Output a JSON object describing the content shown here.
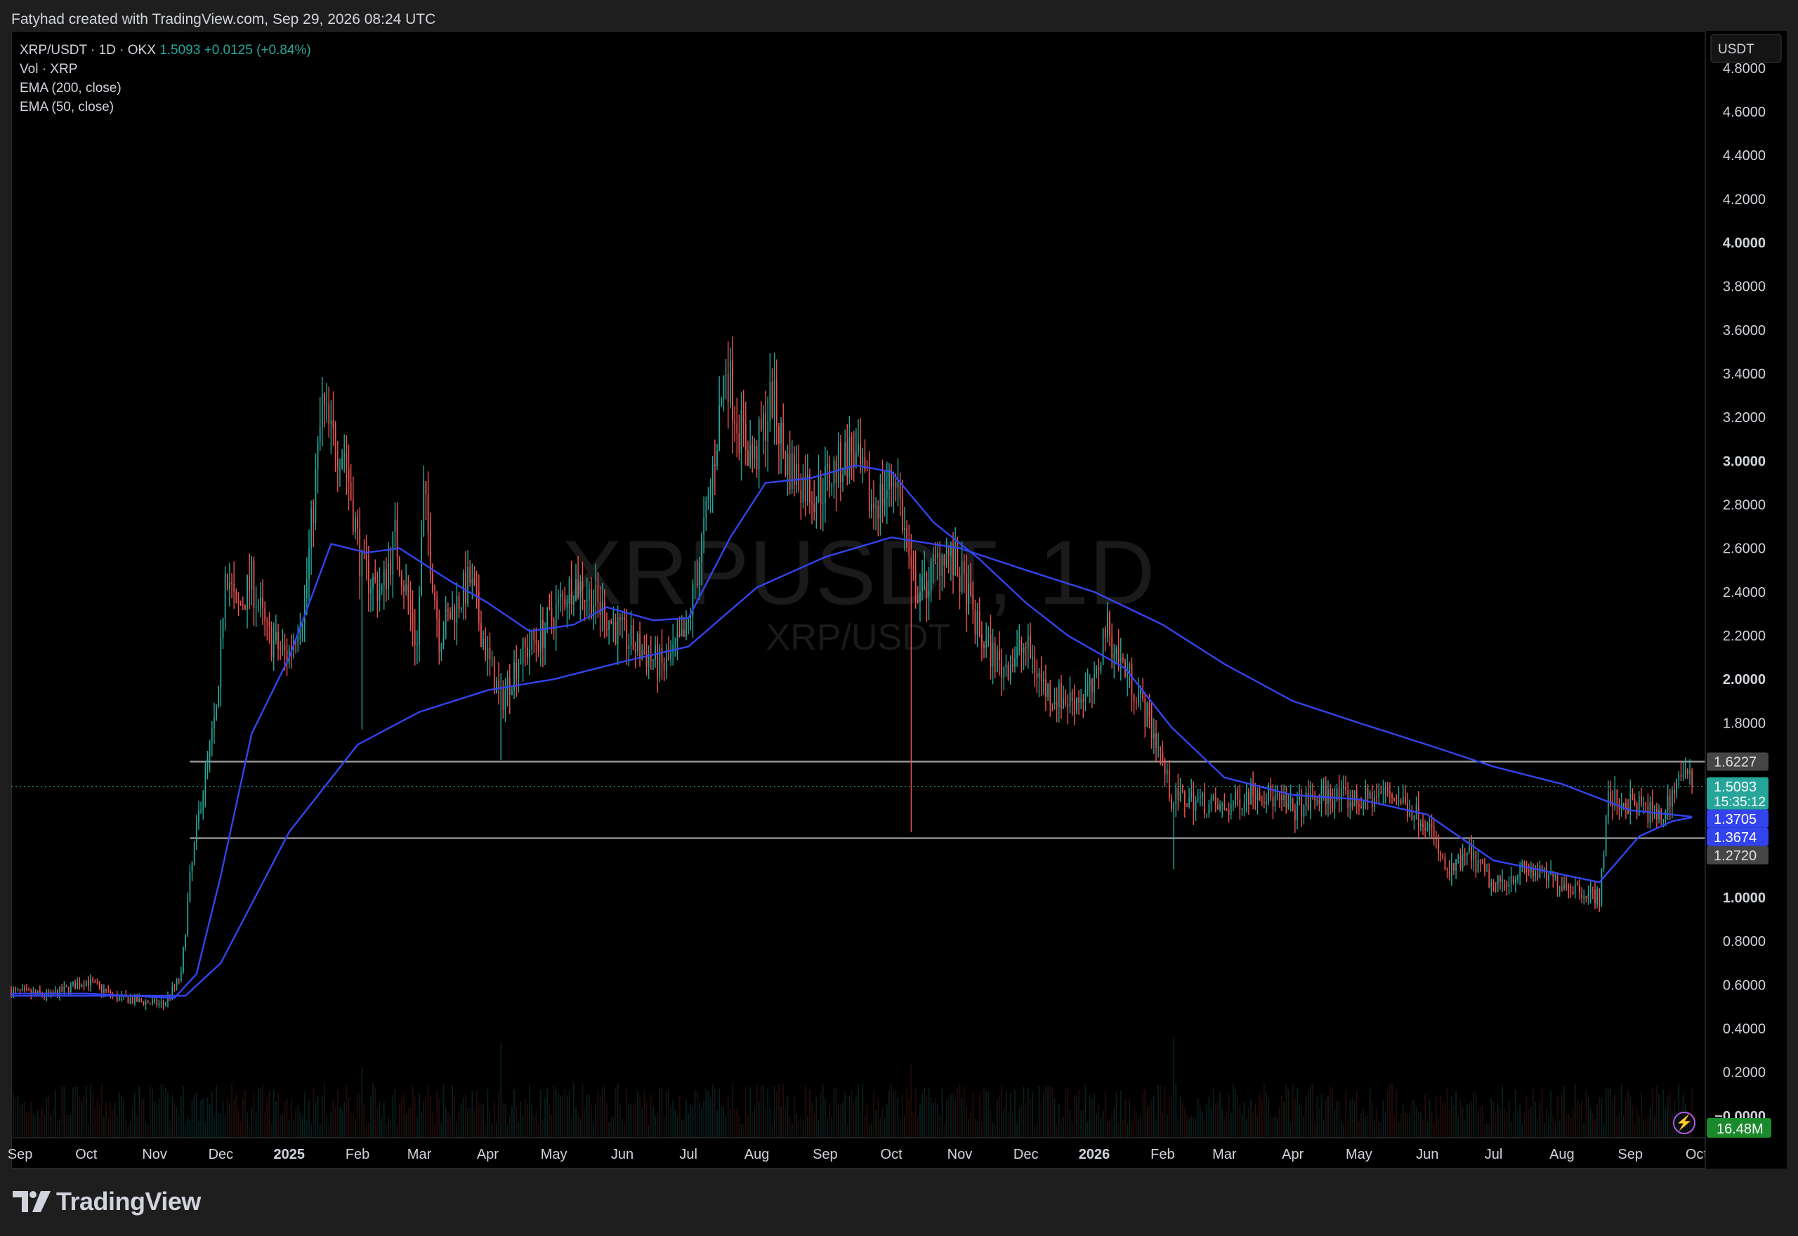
{
  "header": {
    "credit": "Fatyhad created with TradingView.com, Sep 29, 2026 08:24 UTC"
  },
  "legend": {
    "symbol": "XRP/USDT · 1D · OKX",
    "last": "1.5093",
    "change": "+0.0125 (+0.84%)",
    "vol": "Vol · XRP",
    "ema200": "EMA (200, close)",
    "ema50": "EMA (50, close)"
  },
  "watermark": {
    "big": "XRPUSDT, 1D",
    "small": "XRP/USDT"
  },
  "brand": {
    "name": "TradingView"
  },
  "colors": {
    "up": "#26a69a",
    "down": "#ef5350",
    "ema": "#3344ee",
    "level_line": "#9e9e9e",
    "last_price_badge": "#26a69a",
    "volume_badge": "#1b8a2d"
  },
  "icons": [
    "tradingview-logo-icon",
    "bolt-icon"
  ],
  "chart_data": {
    "type": "candlestick",
    "currency_label": "USDT",
    "ylim": [
      -0.1,
      4.97
    ],
    "y_ticks": [
      {
        "label": "4.8000",
        "value": 4.8,
        "bold": false
      },
      {
        "label": "4.6000",
        "value": 4.6,
        "bold": false
      },
      {
        "label": "4.4000",
        "value": 4.4,
        "bold": false
      },
      {
        "label": "4.2000",
        "value": 4.2,
        "bold": false
      },
      {
        "label": "4.0000",
        "value": 4.0,
        "bold": true
      },
      {
        "label": "3.8000",
        "value": 3.8,
        "bold": false
      },
      {
        "label": "3.6000",
        "value": 3.6,
        "bold": false
      },
      {
        "label": "3.4000",
        "value": 3.4,
        "bold": false
      },
      {
        "label": "3.2000",
        "value": 3.2,
        "bold": false
      },
      {
        "label": "3.0000",
        "value": 3.0,
        "bold": true
      },
      {
        "label": "2.8000",
        "value": 2.8,
        "bold": false
      },
      {
        "label": "2.6000",
        "value": 2.6,
        "bold": false
      },
      {
        "label": "2.4000",
        "value": 2.4,
        "bold": false
      },
      {
        "label": "2.2000",
        "value": 2.2,
        "bold": false
      },
      {
        "label": "2.0000",
        "value": 2.0,
        "bold": true
      },
      {
        "label": "1.8000",
        "value": 1.8,
        "bold": false
      },
      {
        "label": "1.0000",
        "value": 1.0,
        "bold": true
      },
      {
        "label": "0.8000",
        "value": 0.8,
        "bold": false
      },
      {
        "label": "0.6000",
        "value": 0.6,
        "bold": false
      },
      {
        "label": "0.4000",
        "value": 0.4,
        "bold": false
      },
      {
        "label": "0.2000",
        "value": 0.2,
        "bold": false
      },
      {
        "label": "−0.0000",
        "value": 0.0,
        "bold": true
      }
    ],
    "x_ticks": [
      {
        "label": "Sep",
        "date": "2024-09-01",
        "bold": false
      },
      {
        "label": "Oct",
        "date": "2024-10-01",
        "bold": false
      },
      {
        "label": "Nov",
        "date": "2024-11-01",
        "bold": false
      },
      {
        "label": "Dec",
        "date": "2024-12-01",
        "bold": false
      },
      {
        "label": "2025",
        "date": "2025-01-01",
        "bold": true
      },
      {
        "label": "Feb",
        "date": "2025-02-01",
        "bold": false
      },
      {
        "label": "Mar",
        "date": "2025-03-01",
        "bold": false
      },
      {
        "label": "Apr",
        "date": "2025-04-01",
        "bold": false
      },
      {
        "label": "May",
        "date": "2025-05-01",
        "bold": false
      },
      {
        "label": "Jun",
        "date": "2025-06-01",
        "bold": false
      },
      {
        "label": "Jul",
        "date": "2025-07-01",
        "bold": false
      },
      {
        "label": "Aug",
        "date": "2025-08-01",
        "bold": false
      },
      {
        "label": "Sep",
        "date": "2025-09-01",
        "bold": false
      },
      {
        "label": "Oct",
        "date": "2025-10-01",
        "bold": false
      },
      {
        "label": "Nov",
        "date": "2025-11-01",
        "bold": false
      },
      {
        "label": "Dec",
        "date": "2025-12-01",
        "bold": false
      },
      {
        "label": "2026",
        "date": "2026-01-01",
        "bold": true
      },
      {
        "label": "Feb",
        "date": "2026-02-01",
        "bold": false
      },
      {
        "label": "Mar",
        "date": "2026-03-01",
        "bold": false
      },
      {
        "label": "Apr",
        "date": "2026-04-01",
        "bold": false
      },
      {
        "label": "May",
        "date": "2026-05-01",
        "bold": false
      },
      {
        "label": "Jun",
        "date": "2026-06-01",
        "bold": false
      },
      {
        "label": "Jul",
        "date": "2026-07-01",
        "bold": false
      },
      {
        "label": "Aug",
        "date": "2026-08-01",
        "bold": false
      },
      {
        "label": "Sep",
        "date": "2026-09-01",
        "bold": false
      },
      {
        "label": "Oct",
        "date": "2026-10-01",
        "bold": false
      }
    ],
    "price_path": [
      [
        "2024-08-28",
        0.57
      ],
      [
        "2024-09-15",
        0.55
      ],
      [
        "2024-10-01",
        0.62
      ],
      [
        "2024-10-15",
        0.54
      ],
      [
        "2024-11-05",
        0.51
      ],
      [
        "2024-11-13",
        0.64
      ],
      [
        "2024-11-17",
        1.08
      ],
      [
        "2024-11-22",
        1.45
      ],
      [
        "2024-11-30",
        1.9
      ],
      [
        "2024-12-03",
        2.55
      ],
      [
        "2024-12-08",
        2.3
      ],
      [
        "2024-12-15",
        2.45
      ],
      [
        "2024-12-22",
        2.2
      ],
      [
        "2024-12-31",
        2.1
      ],
      [
        "2025-01-08",
        2.35
      ],
      [
        "2025-01-16",
        3.25
      ],
      [
        "2025-01-20",
        3.1
      ],
      [
        "2025-01-26",
        3.05
      ],
      [
        "2025-02-03",
        2.5
      ],
      [
        "2025-02-12",
        2.4
      ],
      [
        "2025-02-18",
        2.65
      ],
      [
        "2025-02-28",
        2.15
      ],
      [
        "2025-03-03",
        2.85
      ],
      [
        "2025-03-10",
        2.2
      ],
      [
        "2025-03-18",
        2.35
      ],
      [
        "2025-03-24",
        2.45
      ],
      [
        "2025-04-01",
        2.1
      ],
      [
        "2025-04-07",
        1.9
      ],
      [
        "2025-04-15",
        2.1
      ],
      [
        "2025-04-25",
        2.2
      ],
      [
        "2025-05-10",
        2.45
      ],
      [
        "2025-05-20",
        2.35
      ],
      [
        "2025-06-01",
        2.2
      ],
      [
        "2025-06-20",
        2.05
      ],
      [
        "2025-06-30",
        2.2
      ],
      [
        "2025-07-10",
        2.8
      ],
      [
        "2025-07-18",
        3.45
      ],
      [
        "2025-07-24",
        3.15
      ],
      [
        "2025-07-31",
        3.0
      ],
      [
        "2025-08-08",
        3.3
      ],
      [
        "2025-08-14",
        3.0
      ],
      [
        "2025-08-22",
        2.9
      ],
      [
        "2025-08-28",
        2.85
      ],
      [
        "2025-09-05",
        2.95
      ],
      [
        "2025-09-13",
        3.05
      ],
      [
        "2025-09-22",
        2.8
      ],
      [
        "2025-09-28",
        2.85
      ],
      [
        "2025-10-03",
        2.95
      ],
      [
        "2025-10-10",
        2.45
      ],
      [
        "2025-10-15",
        2.4
      ],
      [
        "2025-10-25",
        2.6
      ],
      [
        "2025-11-02",
        2.45
      ],
      [
        "2025-11-10",
        2.2
      ],
      [
        "2025-11-20",
        2.05
      ],
      [
        "2025-12-01",
        2.15
      ],
      [
        "2025-12-10",
        1.95
      ],
      [
        "2025-12-20",
        1.9
      ],
      [
        "2026-01-01",
        1.95
      ],
      [
        "2026-01-06",
        2.25
      ],
      [
        "2026-01-12",
        2.1
      ],
      [
        "2026-01-20",
        1.95
      ],
      [
        "2026-01-30",
        1.7
      ],
      [
        "2026-02-05",
        1.45
      ],
      [
        "2026-02-15",
        1.45
      ],
      [
        "2026-03-01",
        1.4
      ],
      [
        "2026-03-15",
        1.5
      ],
      [
        "2026-04-01",
        1.4
      ],
      [
        "2026-04-15",
        1.47
      ],
      [
        "2026-05-01",
        1.44
      ],
      [
        "2026-05-15",
        1.48
      ],
      [
        "2026-06-01",
        1.35
      ],
      [
        "2026-06-10",
        1.1
      ],
      [
        "2026-06-20",
        1.2
      ],
      [
        "2026-07-01",
        1.05
      ],
      [
        "2026-07-15",
        1.13
      ],
      [
        "2026-08-01",
        1.07
      ],
      [
        "2026-08-18",
        1.0
      ],
      [
        "2026-08-22",
        1.45
      ],
      [
        "2026-09-05",
        1.42
      ],
      [
        "2026-09-15",
        1.36
      ],
      [
        "2026-09-24",
        1.58
      ],
      [
        "2026-09-29",
        1.5093
      ]
    ],
    "wick_spikes": [
      {
        "date": "2025-10-10",
        "low": 1.3
      },
      {
        "date": "2026-02-06",
        "low": 1.13
      },
      {
        "date": "2025-04-07",
        "low": 1.63
      },
      {
        "date": "2025-02-03",
        "low": 1.77
      }
    ],
    "ema50": [
      [
        "2024-08-28",
        0.56
      ],
      [
        "2024-10-01",
        0.56
      ],
      [
        "2024-11-10",
        0.54
      ],
      [
        "2024-11-20",
        0.65
      ],
      [
        "2024-12-01",
        1.1
      ],
      [
        "2024-12-15",
        1.75
      ],
      [
        "2025-01-01",
        2.1
      ],
      [
        "2025-01-20",
        2.62
      ],
      [
        "2025-02-05",
        2.58
      ],
      [
        "2025-02-20",
        2.6
      ],
      [
        "2025-03-15",
        2.45
      ],
      [
        "2025-04-01",
        2.35
      ],
      [
        "2025-04-20",
        2.22
      ],
      [
        "2025-05-10",
        2.25
      ],
      [
        "2025-05-25",
        2.33
      ],
      [
        "2025-06-15",
        2.27
      ],
      [
        "2025-07-01",
        2.28
      ],
      [
        "2025-07-20",
        2.65
      ],
      [
        "2025-08-05",
        2.9
      ],
      [
        "2025-08-25",
        2.92
      ],
      [
        "2025-09-15",
        2.98
      ],
      [
        "2025-10-01",
        2.95
      ],
      [
        "2025-10-20",
        2.72
      ],
      [
        "2025-11-10",
        2.55
      ],
      [
        "2025-12-01",
        2.35
      ],
      [
        "2025-12-20",
        2.2
      ],
      [
        "2026-01-15",
        2.05
      ],
      [
        "2026-02-05",
        1.78
      ],
      [
        "2026-03-01",
        1.55
      ],
      [
        "2026-04-01",
        1.47
      ],
      [
        "2026-05-01",
        1.45
      ],
      [
        "2026-06-01",
        1.38
      ],
      [
        "2026-07-01",
        1.17
      ],
      [
        "2026-08-18",
        1.07
      ],
      [
        "2026-09-05",
        1.28
      ],
      [
        "2026-09-20",
        1.35
      ],
      [
        "2026-09-29",
        1.3674
      ]
    ],
    "ema200": [
      [
        "2024-08-28",
        0.55
      ],
      [
        "2024-11-15",
        0.55
      ],
      [
        "2024-12-01",
        0.7
      ],
      [
        "2025-01-01",
        1.3
      ],
      [
        "2025-02-01",
        1.7
      ],
      [
        "2025-03-01",
        1.85
      ],
      [
        "2025-04-01",
        1.95
      ],
      [
        "2025-05-01",
        2.0
      ],
      [
        "2025-06-01",
        2.08
      ],
      [
        "2025-07-01",
        2.15
      ],
      [
        "2025-08-01",
        2.42
      ],
      [
        "2025-09-01",
        2.56
      ],
      [
        "2025-10-01",
        2.65
      ],
      [
        "2025-11-01",
        2.6
      ],
      [
        "2025-12-01",
        2.5
      ],
      [
        "2026-01-01",
        2.4
      ],
      [
        "2026-02-01",
        2.25
      ],
      [
        "2026-03-01",
        2.07
      ],
      [
        "2026-04-01",
        1.9
      ],
      [
        "2026-05-01",
        1.8
      ],
      [
        "2026-06-01",
        1.7
      ],
      [
        "2026-07-01",
        1.6
      ],
      [
        "2026-08-01",
        1.52
      ],
      [
        "2026-09-01",
        1.4
      ],
      [
        "2026-09-29",
        1.3705
      ]
    ],
    "horizontal_levels": [
      1.6227,
      1.272
    ],
    "last_price_line": 1.5093,
    "price_badges": [
      {
        "label": "1.6227",
        "value": 1.6227,
        "color": "#454545",
        "text": "#e0e0e0"
      },
      {
        "label": "1.5093",
        "sub": "15:35:12",
        "value": 1.5093,
        "color": "#26a69a",
        "text": "#ffffff"
      },
      {
        "label": "1.3705",
        "value": 1.3705,
        "color": "#3344ee",
        "text": "#ffffff"
      },
      {
        "label": "1.3674",
        "value": 1.3674,
        "color": "#3344ee",
        "text": "#ffffff"
      },
      {
        "label": "1.2720",
        "value": 1.272,
        "color": "#454545",
        "text": "#e0e0e0"
      }
    ],
    "volume_badge": "16.48M"
  }
}
